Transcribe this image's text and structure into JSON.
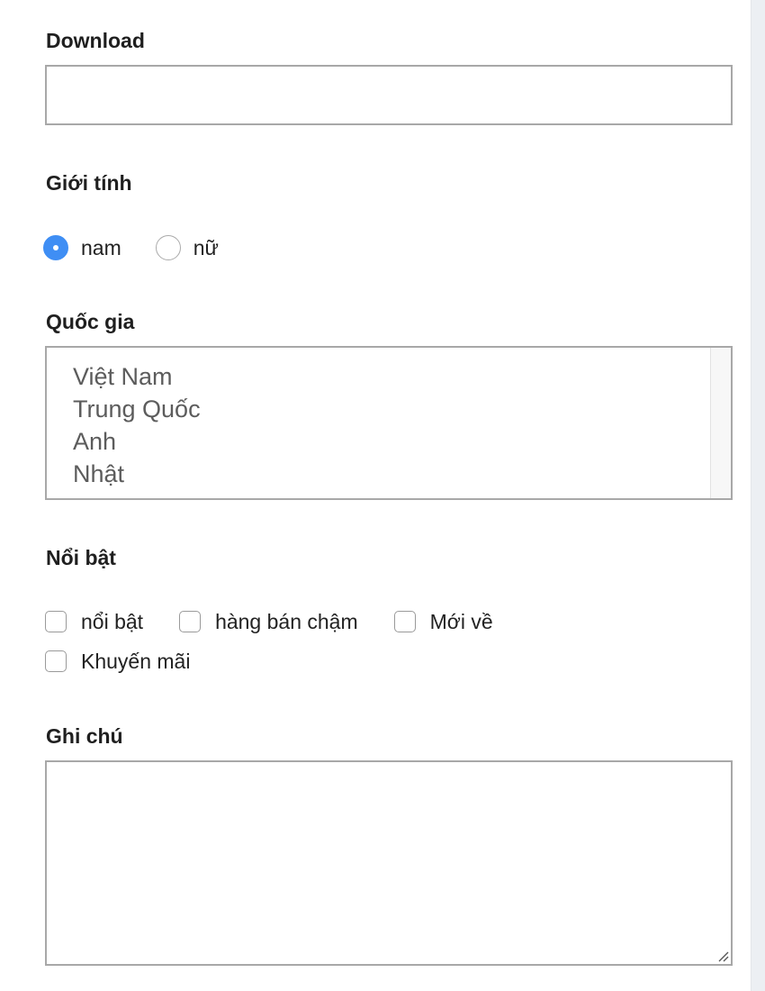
{
  "download": {
    "label": "Download",
    "value": ""
  },
  "gender": {
    "label": "Giới tính",
    "options": [
      {
        "label": "nam",
        "checked": true
      },
      {
        "label": "nữ",
        "checked": false
      }
    ]
  },
  "country": {
    "label": "Quốc gia",
    "options": [
      "Việt Nam",
      "Trung Quốc",
      "Anh",
      "Nhật"
    ]
  },
  "featured": {
    "label": "Nổi bật",
    "options": [
      {
        "label": "nổi bật",
        "checked": false
      },
      {
        "label": "hàng bán chậm",
        "checked": false
      },
      {
        "label": "Mới về",
        "checked": false
      },
      {
        "label": "Khuyến mãi",
        "checked": false
      }
    ]
  },
  "notes": {
    "label": "Ghi chú",
    "value": ""
  },
  "colors": {
    "accent": "#3f8ef4",
    "border": "#a8a8a8"
  }
}
